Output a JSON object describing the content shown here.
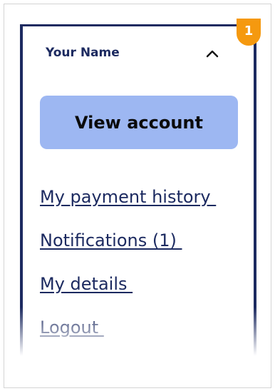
{
  "menu": {
    "user_name": "Your Name",
    "collapse_icon": "chevron-up-icon",
    "notification_count": "1",
    "view_account_label": "View account",
    "links": [
      {
        "label": "My payment history "
      },
      {
        "label": "Notifications (1) "
      },
      {
        "label": "My details "
      },
      {
        "label": "Logout "
      }
    ]
  },
  "colors": {
    "navy": "#1c2a60",
    "button_bg": "#9db7f2",
    "badge_bg": "#f5990f"
  }
}
